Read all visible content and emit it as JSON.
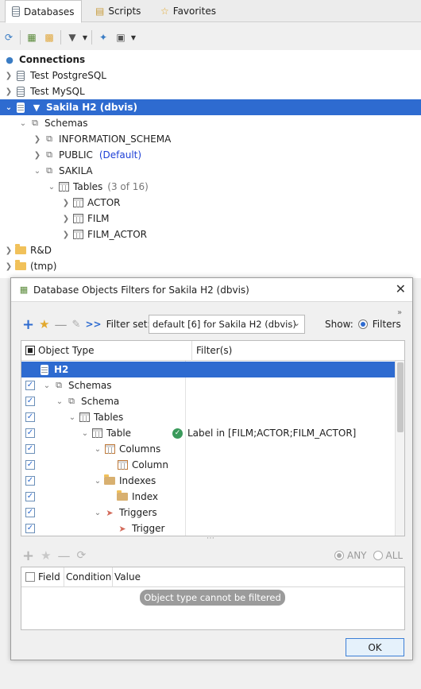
{
  "tabs": [
    {
      "label": "Databases",
      "icon": "database-icon"
    },
    {
      "label": "Scripts",
      "icon": "script-icon"
    },
    {
      "label": "Favorites",
      "icon": "star-icon"
    }
  ],
  "tree": {
    "connections_label": "Connections",
    "items": [
      {
        "label": "Test PostgreSQL"
      },
      {
        "label": "Test MySQL"
      },
      {
        "label": "Sakila H2 (dbvis)"
      },
      {
        "label": "Schemas"
      },
      {
        "label": "INFORMATION_SCHEMA"
      },
      {
        "label": "PUBLIC",
        "suffix": "(Default)"
      },
      {
        "label": "SAKILA"
      },
      {
        "label": "Tables",
        "suffix": "(3 of 16)"
      },
      {
        "label": "ACTOR"
      },
      {
        "label": "FILM"
      },
      {
        "label": "FILM_ACTOR"
      },
      {
        "label": "R&D"
      },
      {
        "label": "(tmp)"
      }
    ]
  },
  "dialog": {
    "title": "Database Objects Filters for Sakila H2 (dbvis)",
    "filter_set_label": "Filter set:",
    "filter_set_value": "default [6] for Sakila H2 (dbvis)",
    "show_label": "Show:",
    "show_option": "Filters",
    "columns": [
      "Object Type",
      "Filter(s)"
    ],
    "rows": [
      {
        "label": "H2",
        "checked": false
      },
      {
        "label": "Schemas",
        "checked": true
      },
      {
        "label": "Schema",
        "checked": true
      },
      {
        "label": "Tables",
        "checked": true
      },
      {
        "label": "Table",
        "checked": true,
        "filter": "Label in [FILM;ACTOR;FILM_ACTOR]"
      },
      {
        "label": "Columns",
        "checked": true
      },
      {
        "label": "Column",
        "checked": true
      },
      {
        "label": "Indexes",
        "checked": true
      },
      {
        "label": "Index",
        "checked": true
      },
      {
        "label": "Triggers",
        "checked": true
      },
      {
        "label": "Trigger",
        "checked": true
      }
    ],
    "match_any": "ANY",
    "match_all": "ALL",
    "lower_columns": [
      "Field",
      "Condition",
      "Value"
    ],
    "tooltip": "Object type cannot be filtered",
    "ok_label": "OK"
  },
  "colors": {
    "selection": "#2e6bd0",
    "accent": "#3a7cc4"
  }
}
